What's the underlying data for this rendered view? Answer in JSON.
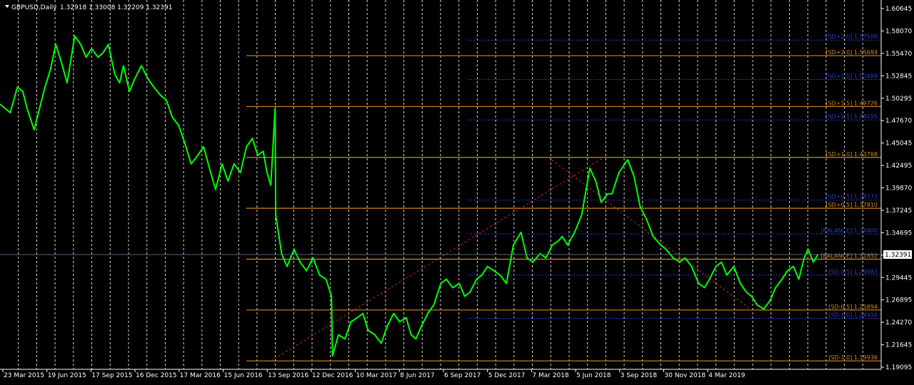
{
  "window": {
    "symbol_title": "GBPUSD,Daily",
    "ohlc": "1.32918 1.33008 1.32209 1.32391",
    "current_price": "1.32391"
  },
  "colors": {
    "background": "#000000",
    "price_line": "#00ff00",
    "grid": "#ffffff",
    "axis_text": "#ffffff",
    "orange_level": "#d4881f",
    "blue_level": "#2a3ccf",
    "trendline": "#cc2a2a",
    "bid_line": "#4d6a86",
    "price_tag_bg": "#ffffff",
    "price_tag_text": "#000000"
  },
  "price_axis": {
    "labels": [
      "1.60645",
      "1.58070",
      "1.55470",
      "1.52845",
      "1.50295",
      "1.47670",
      "1.45045",
      "1.42495",
      "1.39870",
      "1.37245",
      "1.34695",
      "1.32070",
      "1.29445",
      "1.26895",
      "1.24270",
      "1.21645",
      "1.19095"
    ]
  },
  "time_axis": {
    "labels": [
      "23 Mar 2015",
      "19 Jun 2015",
      "17 Sep 2015",
      "16 Dec 2015",
      "17 Mar 2016",
      "15 Jun 2016",
      "13 Sep 2016",
      "12 Dec 2016",
      "10 Mar 2017",
      "8 Jun 2017",
      "6 Sep 2017",
      "5 Dec 2017",
      "7 Mar 2018",
      "5 Jun 2018",
      "3 Sep 2018",
      "30 Nov 2018",
      "4 Mar 2019"
    ]
  },
  "levels": [
    {
      "label": "[SD+2.0] 1.57508",
      "price": 1.57508,
      "color": "blue"
    },
    {
      "label": "[SD+2.0] 1.55684",
      "price": 1.55684,
      "color": "orange"
    },
    {
      "label": "[SD+1.0] 1.52889",
      "price": 1.52889,
      "color": "blue"
    },
    {
      "label": "[SD+1.5] 1.49726",
      "price": 1.49726,
      "color": "orange"
    },
    {
      "label": "[SD+1.5] 1.48155",
      "price": 1.48155,
      "color": "blue"
    },
    {
      "label": "[SD+1.0] 1.43768",
      "price": 1.43768,
      "color": "orange"
    },
    {
      "label": "[SD+0.5] 1.38773",
      "price": 1.38773,
      "color": "blue"
    },
    {
      "label": "[SD+0.5] 1.37810",
      "price": 1.3781,
      "color": "orange"
    },
    {
      "label": "[BALANCE] 1.34800",
      "price": 1.348,
      "color": "blue"
    },
    {
      "label": "[BALANCE] 1.31852",
      "price": 1.31852,
      "color": "orange"
    },
    {
      "label": "[SD-0.5] 1.29983",
      "price": 1.29983,
      "color": "blue"
    },
    {
      "label": "[SD-0.5] 1.25894",
      "price": 1.25894,
      "color": "orange"
    },
    {
      "label": "[SD-1.0] 1.24916",
      "price": 1.24916,
      "color": "blue"
    },
    {
      "label": "[SD-1.0] 1.19936",
      "price": 1.19936,
      "color": "orange"
    }
  ],
  "chart_data": {
    "type": "line",
    "series": [
      {
        "name": "GBPUSD,Daily",
        "x": [
          "2015-02-01",
          "2015-02-20",
          "2015-03-05",
          "2015-03-15",
          "2015-03-23",
          "2015-04-05",
          "2015-04-13",
          "2015-04-25",
          "2015-05-05",
          "2015-05-15",
          "2015-05-25",
          "2015-06-05",
          "2015-06-19",
          "2015-06-30",
          "2015-07-10",
          "2015-07-20",
          "2015-08-01",
          "2015-08-10",
          "2015-08-20",
          "2015-09-01",
          "2015-09-10",
          "2015-09-17",
          "2015-09-28",
          "2015-10-08",
          "2015-10-20",
          "2015-11-01",
          "2015-11-12",
          "2015-11-25",
          "2015-12-05",
          "2015-12-16",
          "2015-12-28",
          "2016-01-08",
          "2016-01-20",
          "2016-02-01",
          "2016-02-12",
          "2016-02-25",
          "2016-03-05",
          "2016-03-17",
          "2016-03-28",
          "2016-04-08",
          "2016-04-20",
          "2016-05-01",
          "2016-05-12",
          "2016-05-22",
          "2016-06-01",
          "2016-06-08",
          "2016-06-15",
          "2016-06-23",
          "2016-06-24",
          "2016-07-05",
          "2016-07-15",
          "2016-07-28",
          "2016-08-08",
          "2016-08-20",
          "2016-09-01",
          "2016-09-13",
          "2016-09-25",
          "2016-10-05",
          "2016-10-07",
          "2016-10-18",
          "2016-10-30",
          "2016-11-10",
          "2016-11-22",
          "2016-12-02",
          "2016-12-12",
          "2016-12-24",
          "2017-01-05",
          "2017-01-16",
          "2017-01-28",
          "2017-02-08",
          "2017-02-20",
          "2017-03-01",
          "2017-03-10",
          "2017-03-20",
          "2017-04-01",
          "2017-04-12",
          "2017-04-25",
          "2017-05-05",
          "2017-05-17",
          "2017-05-29",
          "2017-06-08",
          "2017-06-18",
          "2017-06-30",
          "2017-07-10",
          "2017-07-20",
          "2017-08-01",
          "2017-08-12",
          "2017-08-24",
          "2017-09-06",
          "2017-09-20",
          "2017-10-01",
          "2017-10-12",
          "2017-10-25",
          "2017-11-05",
          "2017-11-17",
          "2017-11-28",
          "2017-12-05",
          "2017-12-15",
          "2017-12-28",
          "2018-01-10",
          "2018-01-25",
          "2018-02-05",
          "2018-02-15",
          "2018-02-27",
          "2018-03-07",
          "2018-03-20",
          "2018-04-05",
          "2018-04-17",
          "2018-04-28",
          "2018-05-10",
          "2018-05-22",
          "2018-06-05",
          "2018-06-15",
          "2018-06-28",
          "2018-07-10",
          "2018-07-20",
          "2018-08-01",
          "2018-08-14",
          "2018-08-25",
          "2018-09-03",
          "2018-09-15",
          "2018-09-25",
          "2018-10-05",
          "2018-10-18",
          "2018-10-30",
          "2018-11-10",
          "2018-11-20",
          "2018-11-30",
          "2018-12-12",
          "2018-12-24",
          "2019-01-03",
          "2019-01-15",
          "2019-01-25",
          "2019-02-05",
          "2019-02-15",
          "2019-02-25",
          "2019-03-04",
          "2019-03-14",
          "2019-03-22"
        ],
        "y": [
          1.5,
          1.49,
          1.52,
          1.515,
          1.495,
          1.47,
          1.49,
          1.52,
          1.54,
          1.57,
          1.55,
          1.525,
          1.58,
          1.57,
          1.555,
          1.565,
          1.555,
          1.56,
          1.57,
          1.535,
          1.525,
          1.545,
          1.515,
          1.53,
          1.545,
          1.53,
          1.52,
          1.51,
          1.505,
          1.485,
          1.475,
          1.455,
          1.43,
          1.44,
          1.45,
          1.42,
          1.4,
          1.43,
          1.41,
          1.43,
          1.42,
          1.45,
          1.46,
          1.44,
          1.445,
          1.42,
          1.405,
          1.495,
          1.37,
          1.325,
          1.31,
          1.33,
          1.315,
          1.305,
          1.32,
          1.3,
          1.295,
          1.275,
          1.205,
          1.23,
          1.225,
          1.245,
          1.25,
          1.255,
          1.235,
          1.23,
          1.22,
          1.24,
          1.255,
          1.245,
          1.25,
          1.23,
          1.225,
          1.24,
          1.255,
          1.265,
          1.29,
          1.295,
          1.285,
          1.29,
          1.275,
          1.28,
          1.295,
          1.3,
          1.31,
          1.305,
          1.3,
          1.29,
          1.335,
          1.35,
          1.32,
          1.315,
          1.325,
          1.32,
          1.335,
          1.34,
          1.345,
          1.335,
          1.35,
          1.37,
          1.425,
          1.41,
          1.385,
          1.395,
          1.395,
          1.42,
          1.435,
          1.415,
          1.38,
          1.365,
          1.345,
          1.335,
          1.33,
          1.32,
          1.315,
          1.32,
          1.31,
          1.29,
          1.285,
          1.295,
          1.31,
          1.315,
          1.3,
          1.31,
          1.29,
          1.28,
          1.275,
          1.265,
          1.26,
          1.27,
          1.285,
          1.295,
          1.305,
          1.31,
          1.295,
          1.32,
          1.33,
          1.315,
          1.3239
        ]
      }
    ],
    "trendlines": [
      {
        "x1": "2016-06-15",
        "y1": 1.19936,
        "x2": "2018-02-20",
        "y2": 1.43768
      },
      {
        "x1": "2017-11-10",
        "y1": 1.43768,
        "x2": "2018-11-20",
        "y2": 1.25894
      }
    ],
    "ylim": [
      1.1895,
      1.612
    ],
    "xlim": [
      "2015-02-01",
      "2019-07-17"
    ],
    "grid": true,
    "legend": "none"
  }
}
